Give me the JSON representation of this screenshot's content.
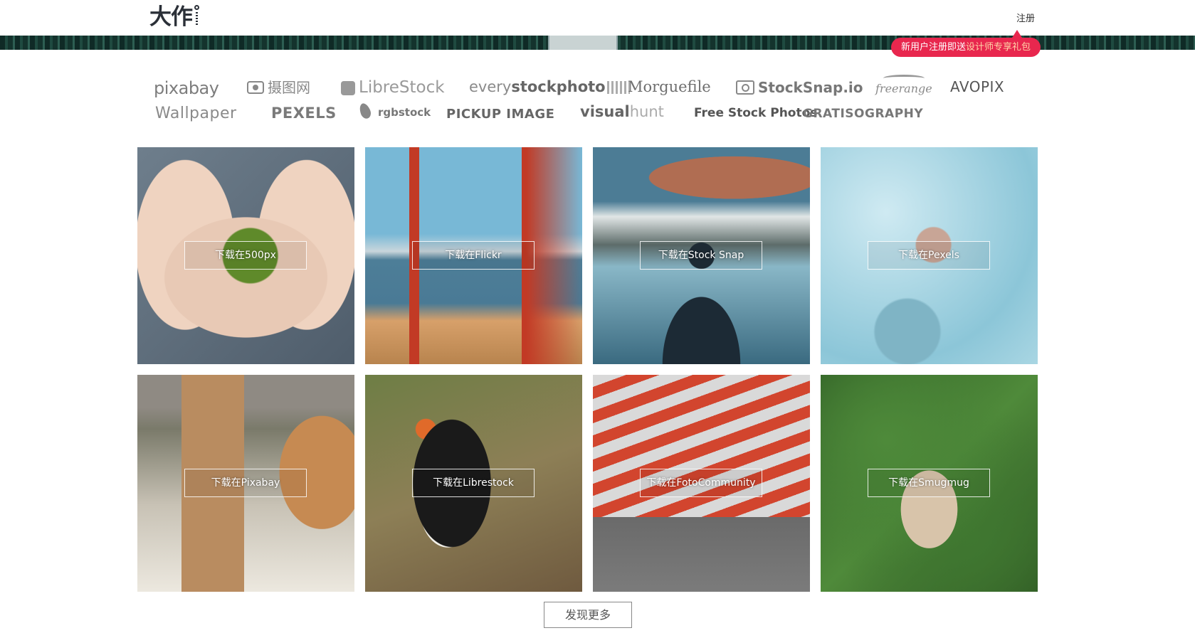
{
  "header": {
    "logo_text": "大作",
    "register_label": "注册"
  },
  "promo": {
    "prefix": "新用户注册即送",
    "highlight": "设计师专享礼包"
  },
  "sources": {
    "pixabay": "pixabay",
    "sheji": "摄图网",
    "librestock": "LibreStock",
    "everystock_a": "every",
    "everystock_b": "stockphoto",
    "morguefile": "Morguefile",
    "stocksnap": "StockSnap.io",
    "freerange": "freerange",
    "avopix": "AVOPIX",
    "wallpaper": "Wallpaper",
    "pexels": "PEXELS",
    "rgbstock": "rgbstock",
    "pickup": "PICKUP IMAGE",
    "visualhunt_a": "visual",
    "visualhunt_b": "hunt",
    "freestock": "Free Stock Photos",
    "gratisography": "GRATISOGRAPHY"
  },
  "tiles": [
    {
      "label": "下载在500px"
    },
    {
      "label": "下载在Flickr"
    },
    {
      "label": "下载在Stock Snap"
    },
    {
      "label": "下载在Pexels"
    },
    {
      "label": "下载在Pixabay"
    },
    {
      "label": "下载在Librestock"
    },
    {
      "label": "下载在FotoCommunity"
    },
    {
      "label": "下载在Smugmug"
    }
  ],
  "more_label": "发现更多",
  "colors": {
    "accent": "#e8274e",
    "banner": "#14332d"
  }
}
